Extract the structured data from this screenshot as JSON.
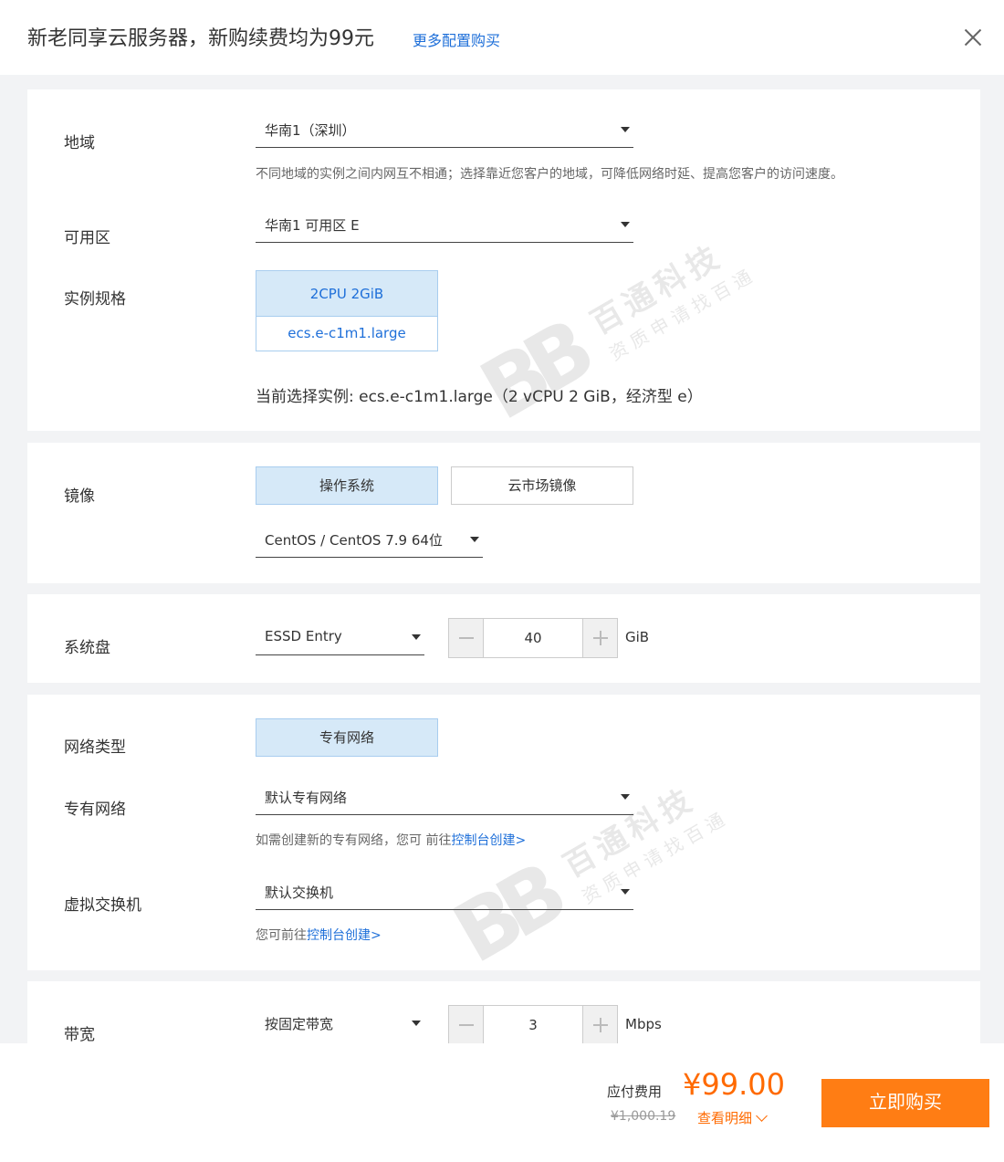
{
  "header": {
    "title": "新老同享云服务器，新购续费均为99元",
    "more_link": "更多配置购买"
  },
  "region": {
    "label": "地域",
    "value": "华南1（深圳）",
    "hint": "不同地域的实例之间内网互不相通；选择靠近您客户的地域，可降低网络时延、提高您客户的访问速度。"
  },
  "zone": {
    "label": "可用区",
    "value": "华南1 可用区 E"
  },
  "instance": {
    "label": "实例规格",
    "spec": "2CPU 2GiB",
    "type": "ecs.e-c1m1.large",
    "current": "当前选择实例: ecs.e-c1m1.large（2 vCPU 2 GiB，经济型 e）"
  },
  "image": {
    "label": "镜像",
    "tabs": [
      "操作系统",
      "云市场镜像"
    ],
    "os_value": "CentOS / CentOS 7.9 64位"
  },
  "disk": {
    "label": "系统盘",
    "type": "ESSD Entry",
    "size": "40",
    "unit": "GiB"
  },
  "network": {
    "type_label": "网络类型",
    "type_value": "专有网络",
    "vpc_label": "专有网络",
    "vpc_value": "默认专有网络",
    "vpc_hint_prefix": "如需创建新的专有网络，您可 前往",
    "vpc_hint_link": "控制台创建>",
    "vswitch_label": "虚拟交换机",
    "vswitch_value": "默认交换机",
    "vswitch_hint_prefix": "您可前往",
    "vswitch_hint_link": "控制台创建>"
  },
  "bandwidth": {
    "label": "带宽",
    "mode": "按固定带宽",
    "value": "3",
    "unit": "Mbps"
  },
  "watermark": {
    "brand": "百通科技",
    "sub": "资质申请找百通"
  },
  "footer": {
    "due_label": "应付费用",
    "price": "¥99.00",
    "original_price": "¥1,000.19",
    "details": "查看明细",
    "buy": "立即购买"
  }
}
